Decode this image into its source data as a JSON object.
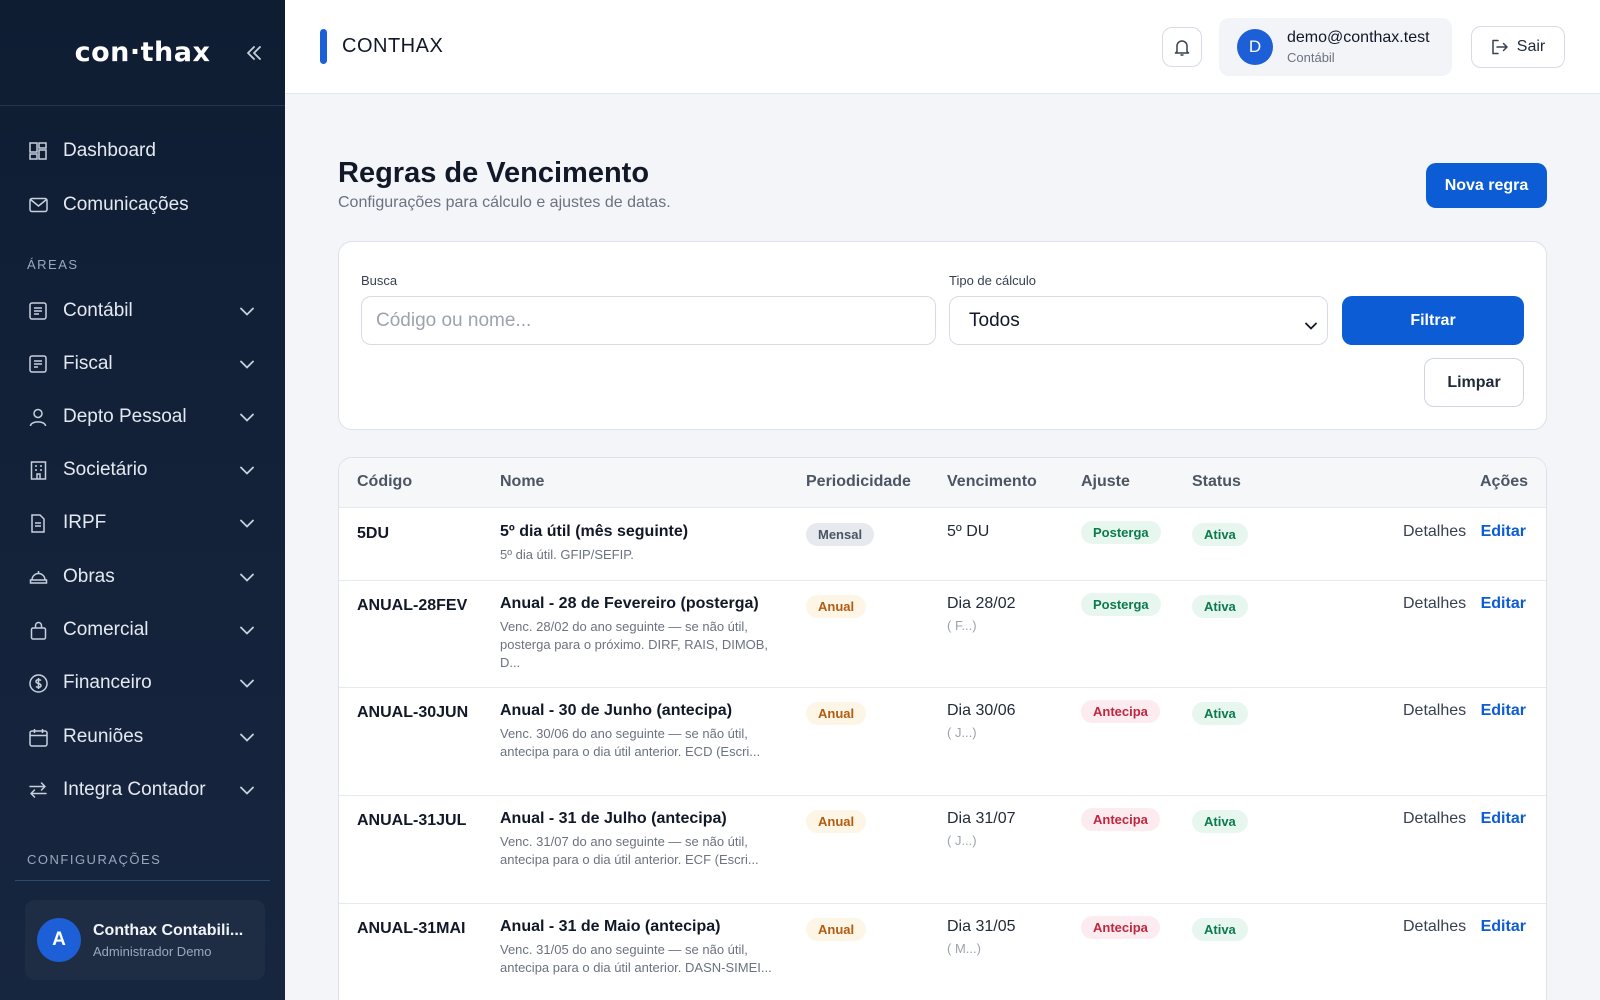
{
  "sidebar": {
    "logo": "con·thax",
    "nav_top": [
      {
        "label": "Dashboard",
        "icon": "dashboard-icon"
      },
      {
        "label": "Comunicações",
        "icon": "mail-icon"
      }
    ],
    "areas_label": "ÁREAS",
    "areas": [
      {
        "label": "Contábil",
        "icon": "ledger-icon"
      },
      {
        "label": "Fiscal",
        "icon": "receipt-icon"
      },
      {
        "label": "Depto Pessoal",
        "icon": "person-icon"
      },
      {
        "label": "Societário",
        "icon": "building-icon"
      },
      {
        "label": "IRPF",
        "icon": "document-icon"
      },
      {
        "label": "Obras",
        "icon": "construction-icon"
      },
      {
        "label": "Comercial",
        "icon": "bag-icon"
      },
      {
        "label": "Financeiro",
        "icon": "dollar-icon"
      },
      {
        "label": "Reuniões",
        "icon": "calendar-icon"
      },
      {
        "label": "Integra Contador",
        "icon": "sync-icon"
      }
    ],
    "config_label": "CONFIGURAÇÕES",
    "user": {
      "initial": "A",
      "name": "Conthax Contabili...",
      "role": "Administrador Demo"
    }
  },
  "topbar": {
    "title": "CONTHAX",
    "account": {
      "initial": "D",
      "email": "demo@conthax.test",
      "role": "Contábil"
    },
    "logout_label": "Sair"
  },
  "page": {
    "title": "Regras de Vencimento",
    "subtitle": "Configurações para cálculo e ajustes de datas.",
    "new_button": "Nova regra"
  },
  "filters": {
    "search_label": "Busca",
    "search_placeholder": "Código ou nome...",
    "type_label": "Tipo de cálculo",
    "type_value": "Todos",
    "filter_button": "Filtrar",
    "clear_button": "Limpar"
  },
  "table": {
    "headers": [
      "Código",
      "Nome",
      "Periodicidade",
      "Vencimento",
      "Ajuste",
      "Status",
      "Ações"
    ],
    "details_label": "Detalhes",
    "edit_label": "Editar",
    "rows": [
      {
        "code": "5DU",
        "name": "5º dia útil (mês seguinte)",
        "desc": "5º dia útil. GFIP/SEFIP.",
        "period": "Mensal",
        "venc": "5º DU",
        "venc_extra": "",
        "adjust": "Posterga",
        "status": "Ativa"
      },
      {
        "code": "ANUAL-28FEV",
        "name": "Anual - 28 de Fevereiro (posterga)",
        "desc": "Venc. 28/02 do ano seguinte — se não útil, posterga para o próximo. DIRF, RAIS, DIMOB, D...",
        "period": "Anual",
        "venc": "Dia 28/02",
        "venc_extra": "( F...)",
        "adjust": "Posterga",
        "status": "Ativa"
      },
      {
        "code": "ANUAL-30JUN",
        "name": "Anual - 30 de Junho (antecipa)",
        "desc": "Venc. 30/06 do ano seguinte — se não útil, antecipa para o dia útil anterior. ECD (Escri...",
        "period": "Anual",
        "venc": "Dia 30/06",
        "venc_extra": "( J...)",
        "adjust": "Antecipa",
        "status": "Ativa"
      },
      {
        "code": "ANUAL-31JUL",
        "name": "Anual - 31 de Julho (antecipa)",
        "desc": "Venc. 31/07 do ano seguinte — se não útil, antecipa para o dia útil anterior. ECF (Escri...",
        "period": "Anual",
        "venc": "Dia 31/07",
        "venc_extra": "( J...)",
        "adjust": "Antecipa",
        "status": "Ativa"
      },
      {
        "code": "ANUAL-31MAI",
        "name": "Anual - 31 de Maio (antecipa)",
        "desc": "Venc. 31/05 do ano seguinte — se não útil, antecipa para o dia útil anterior. DASN-SIMEI...",
        "period": "Anual",
        "venc": "Dia 31/05",
        "venc_extra": "( M...)",
        "adjust": "Antecipa",
        "status": "Ativa"
      }
    ]
  },
  "colors": {
    "primary": "#0b5cd5",
    "sidebar": "#0f1d33"
  }
}
